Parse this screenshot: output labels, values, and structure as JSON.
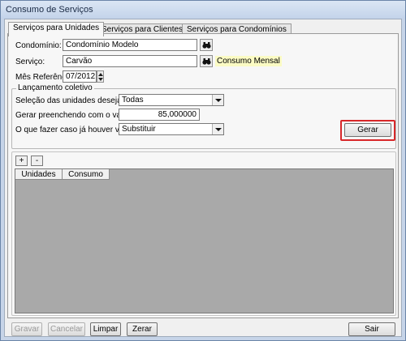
{
  "window": {
    "title": "Consumo de Serviços"
  },
  "tabs": [
    {
      "label": "Serviços para Unidades",
      "active": true
    },
    {
      "label": "Serviços para Clientes",
      "active": false
    },
    {
      "label": "Serviços para Condomínios",
      "active": false
    }
  ],
  "form": {
    "condominio_label": "Condomínio:",
    "condominio_value": "Condomínio Modelo",
    "servico_label": "Serviço:",
    "servico_value": "Carvão",
    "servico_hint": "Consumo Mensal",
    "mes_label": "Mês Referência:",
    "mes_value": "07/2012"
  },
  "lancamento": {
    "title": "Lançamento coletivo",
    "selecao_label": "Seleção das unidades desejadas:",
    "selecao_value": "Todas",
    "gerar_valor_label": "Gerar preenchendo com o valor:",
    "gerar_valor_value": "85,000000",
    "fazer_label": "O que fazer caso já houver valores?",
    "fazer_value": "Substituir",
    "gerar_button": "Gerar"
  },
  "grid": {
    "add_label": "+",
    "remove_label": "-",
    "columns": [
      "Unidades",
      "Consumo"
    ]
  },
  "footer": {
    "gravar": "Gravar",
    "cancelar": "Cancelar",
    "limpar": "Limpar",
    "zerar": "Zerar",
    "sair": "Sair"
  },
  "colors": {
    "highlight": "#d8282a",
    "hint_bg": "#fbfbc4",
    "grid_bg": "#a9a9a9"
  },
  "icons": {
    "search": "binoculars-icon",
    "spinner": "spin-icon"
  }
}
